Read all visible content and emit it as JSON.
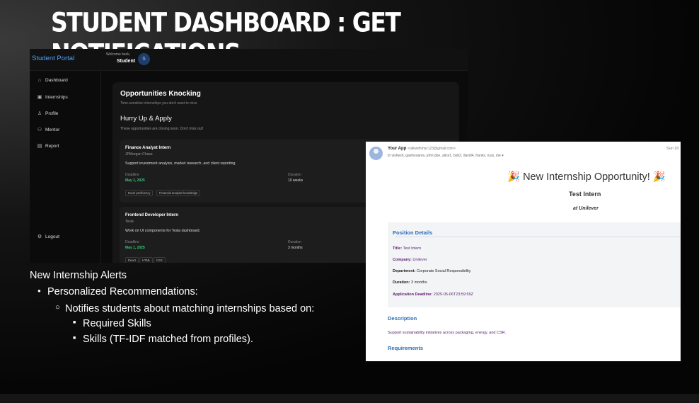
{
  "slide": {
    "title": "STUDENT DASHBOARD : GET NOTIFICATIONS"
  },
  "portal": {
    "brand": "Student Portal",
    "welcome_small": "Welcome back,",
    "welcome_name": "Student",
    "avatar_initial": "S",
    "nav": [
      {
        "label": "Dashboard",
        "icon": "home-icon"
      },
      {
        "label": "Internships",
        "icon": "briefcase-icon"
      },
      {
        "label": "Profile",
        "icon": "user-icon"
      },
      {
        "label": "Mentor",
        "icon": "users-icon"
      },
      {
        "label": "Report",
        "icon": "document-icon"
      }
    ],
    "logout_label": "Logout",
    "card_title": "Opportunities Knocking",
    "card_subtitle": "Time-sensitive internships you don't want to miss",
    "section_title": "Hurry Up & Apply",
    "section_subtitle": "These opportunities are closing soon. Don't miss out!",
    "jobs": [
      {
        "title": "Finance Analyst Intern",
        "company": "JPMorgan Chase",
        "description": "Support investment analysis, market research, and client reporting.",
        "deadline_label": "Deadline",
        "deadline": "May 1, 2025",
        "duration_label": "Duration",
        "duration": "10 weeks",
        "tags": [
          "Excel proficiency",
          "Financial analysis knowledge"
        ]
      },
      {
        "title": "Frontend Developer Intern",
        "company": "Tesla",
        "description": "Work on UI components for Tesla dashboard.",
        "deadline_label": "Deadline",
        "deadline": "May 1, 2025",
        "duration_label": "Duration",
        "duration": "3 months",
        "tags": [
          "React",
          "HTML",
          "CSS"
        ]
      }
    ]
  },
  "notes": {
    "heading": "New Internship Alerts",
    "bullet1": "Personalized Recommendations:",
    "bullet2": "Notifies students about matching internships based on:",
    "bullet3a": "Required Skills",
    "bullet3b": "Skills (TF-IDF matched from profiles)."
  },
  "email": {
    "sender_name": "Your App",
    "sender_email": "<talkwithmsc123@gmail.com>",
    "recipients": "to vishesh, gavinsoares, john.doe, alice1, bob2, david4, franks, russ, me ▾",
    "date": "Sun 20",
    "heading": "🎉 New Internship Opportunity! 🎉",
    "job_title": "Test Intern",
    "company_line": "at Unilever",
    "details_heading": "Position Details",
    "details": [
      {
        "label": "Title:",
        "value": "Test Intern"
      },
      {
        "label": "Company:",
        "value": "Unilever"
      },
      {
        "label": "Department:",
        "value": "Corporate Social Responsibility"
      },
      {
        "label": "Duration:",
        "value": "3 months"
      },
      {
        "label": "Application Deadline:",
        "value": "2025-05-06T23:59:59Z"
      }
    ],
    "description_heading": "Description",
    "description_text": "Support sustainability initiatives across packaging, energy, and CSR.",
    "requirements_heading": "Requirements"
  }
}
